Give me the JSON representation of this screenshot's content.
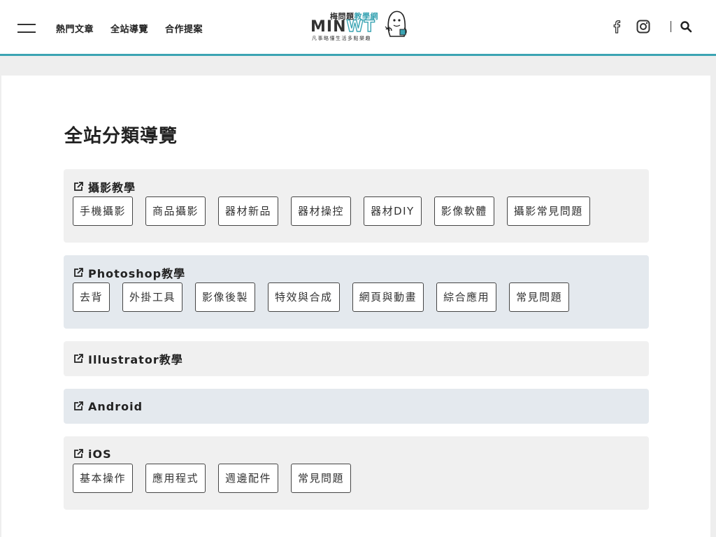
{
  "header": {
    "nav": [
      "熱門文章",
      "全站導覽",
      "合作提案"
    ],
    "logo": {
      "tagline_top_prefix": "梅問題",
      "tagline_top_accent": "教學網",
      "brand_main": "MIN",
      "brand_accent": "WT",
      "tagline_bottom": "凡事略懂生活多點樂趣"
    },
    "icons": {
      "menu": "hamburger-menu-icon",
      "facebook": "facebook-icon",
      "instagram": "instagram-icon",
      "search": "search-icon"
    },
    "accent_color": "#3ba4b3"
  },
  "main": {
    "title": "全站分類導覽",
    "categories": [
      {
        "title": "攝影教學",
        "tags": [
          "手機攝影",
          "商品攝影",
          "器材新品",
          "器材操控",
          "器材DIY",
          "影像軟體",
          "攝影常見問題"
        ]
      },
      {
        "title": "Photoshop教學",
        "tags": [
          "去背",
          "外掛工具",
          "影像後製",
          "特效與合成",
          "網頁與動畫",
          "綜合應用",
          "常見問題"
        ]
      },
      {
        "title": "Illustrator教學",
        "tags": []
      },
      {
        "title": "Android",
        "tags": []
      },
      {
        "title": "iOS",
        "tags": [
          "基本操作",
          "應用程式",
          "週邊配件",
          "常見問題"
        ]
      }
    ]
  }
}
